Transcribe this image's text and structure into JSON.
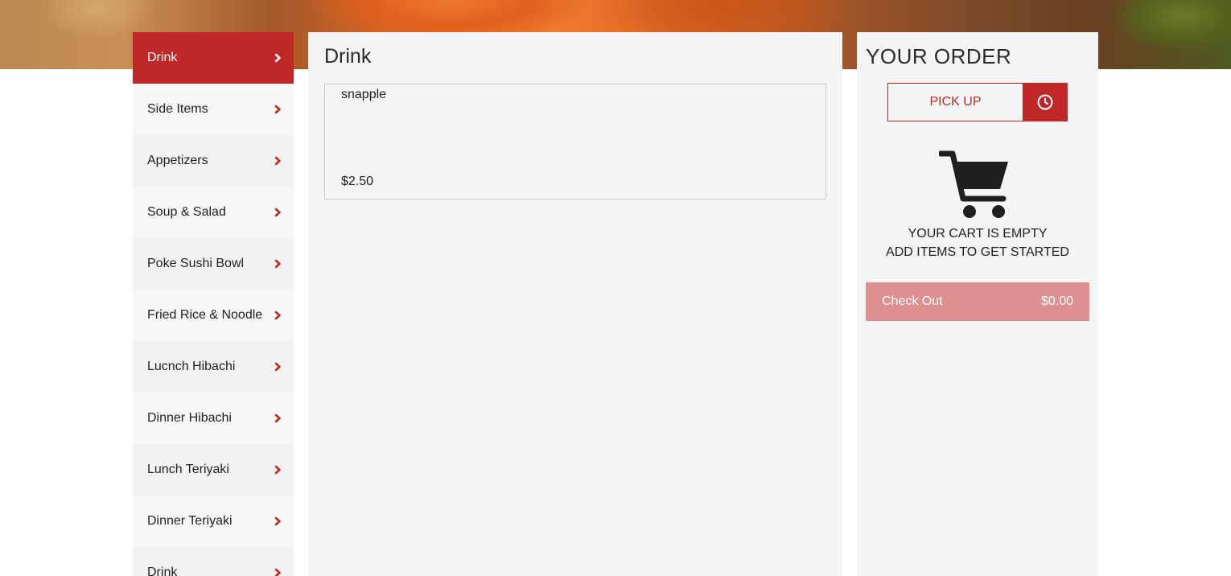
{
  "colors": {
    "accent": "#c02727",
    "checkout_disabled": "#de8f8f",
    "panel": "#f4f4f4"
  },
  "sidebar": {
    "items": [
      {
        "label": "Drink",
        "active": true
      },
      {
        "label": "Side Items"
      },
      {
        "label": "Appetizers"
      },
      {
        "label": "Soup & Salad"
      },
      {
        "label": "Poke Sushi Bowl"
      },
      {
        "label": "Fried Rice & Noodle"
      },
      {
        "label": "Lucnch Hibachi"
      },
      {
        "label": "Dinner Hibachi"
      },
      {
        "label": "Lunch Teriyaki"
      },
      {
        "label": "Dinner Teriyaki"
      },
      {
        "label": "Drink"
      }
    ],
    "item_icon": "chevron-right-icon"
  },
  "main": {
    "title": "Drink",
    "items": [
      {
        "name": "snapple",
        "price": "$2.50"
      }
    ]
  },
  "order": {
    "title": "YOUR ORDER",
    "pickup_label": "PICK UP",
    "schedule_icon": "clock-icon",
    "cart_icon": "shopping-cart-icon",
    "empty_line1": "YOUR CART IS EMPTY",
    "empty_line2": "ADD ITEMS TO GET STARTED",
    "checkout_label": "Check Out",
    "checkout_total": "$0.00"
  }
}
